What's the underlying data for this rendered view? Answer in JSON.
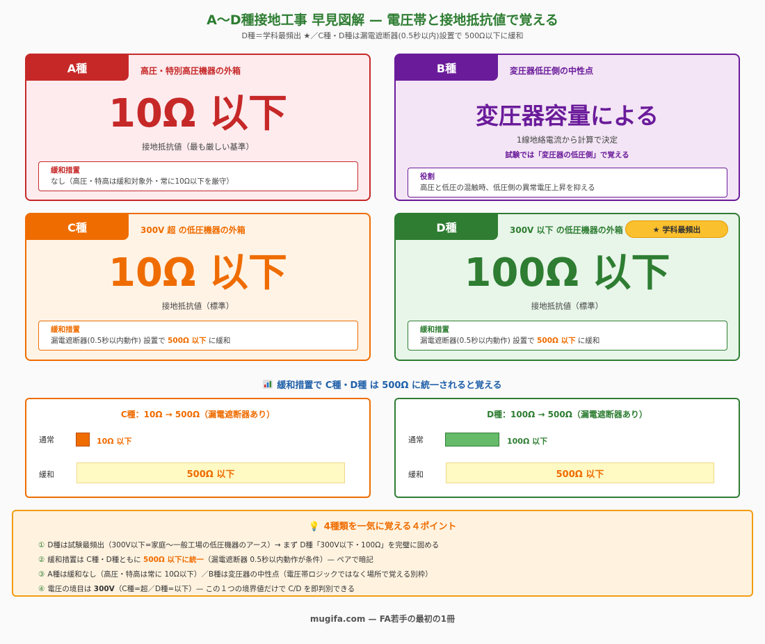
{
  "header": {
    "title": "A〜D種接地工事 早見図解 — 電圧帯と接地抵抗値で覚える",
    "subtitle": "D種＝学科最頻出 ★／C種・D種は漏電遮断器(0.5秒以内)設置で 500Ω以下に緩和"
  },
  "cards": {
    "a": {
      "label": "A種",
      "scope": "高圧・特別高圧機器の外箱",
      "value": "10Ω 以下",
      "caption": "接地抵抗値（最も厳しい基準）",
      "box_title": "緩和措置",
      "box_text": "なし（高圧・特高は緩和対象外・常に10Ω以下を厳守）",
      "color": "#c62828"
    },
    "b": {
      "label": "B種",
      "scope": "変圧器低圧側の中性点",
      "value": "変圧器容量による",
      "caption": "1線地絡電流から計算で決定",
      "note": "試験では「変圧器の低圧側」で覚える",
      "box_title": "役割",
      "box_text": "高圧と低圧の混触時、低圧側の異常電圧上昇を抑える",
      "color": "#6a1b9a"
    },
    "c": {
      "label": "C種",
      "scope": "300V 超 の低圧機器の外箱",
      "value": "10Ω 以下",
      "caption": "接地抵抗値（標準）",
      "box_title": "緩和措置",
      "box_text_pre": "漏電遮断器(0.5秒以内動作) 設置で ",
      "box_text_em": "500Ω 以下",
      "box_text_post": " に緩和",
      "color": "#ef6c00"
    },
    "d": {
      "label": "D種",
      "scope": "300V 以下 の低圧機器の外箱",
      "badge": "★ 学科最頻出",
      "value": "100Ω 以下",
      "caption": "接地抵抗値（標準）",
      "box_title": "緩和措置",
      "box_text_pre": "漏電遮断器(0.5秒以内動作) 設置で ",
      "box_text_em": "500Ω 以下",
      "box_text_post": " に緩和",
      "color": "#2e7d32"
    }
  },
  "comparison": {
    "title": "緩和措置で C種・D種 は 500Ω に統一されると覚える",
    "icon": "bar-chart-icon",
    "c": {
      "title": "C種：10Ω → 500Ω（漏電遮断器あり）",
      "row1_label": "通常",
      "row1_value": "10Ω 以下",
      "row2_label": "緩和",
      "row2_value": "500Ω 以下"
    },
    "d": {
      "title": "D種：100Ω → 500Ω（漏電遮断器あり）",
      "row1_label": "通常",
      "row1_value": "100Ω 以下",
      "row2_label": "緩和",
      "row2_value": "500Ω 以下"
    }
  },
  "points": {
    "title": "4種類を一気に覚える４ポイント",
    "icon": "lightbulb-icon",
    "items": [
      {
        "num": "①",
        "text": "D種は試験最頻出（300V以下=家庭〜一般工場の低圧機器のアース）→ まず D種「300V以下・100Ω」を完璧に固める"
      },
      {
        "num": "②",
        "pre": "緩和措置は C種・D種ともに ",
        "em": "500Ω 以下に統一",
        "post": "（漏電遮断器 0.5秒以内動作が条件）— ペアで暗記"
      },
      {
        "num": "③",
        "text": "A種は緩和なし（高圧・特高は常に 10Ω以下）／B種は変圧器の中性点（電圧帯ロジックではなく場所で覚える別枠）"
      },
      {
        "num": "④",
        "pre": "電圧の境目は ",
        "em": "300V",
        "post": "（C種=超／D種=以下）— この１つの境界値だけで C/D を即判別できる"
      }
    ]
  },
  "footer": {
    "text": "mugifa.com — FA若手の最初の1冊"
  }
}
